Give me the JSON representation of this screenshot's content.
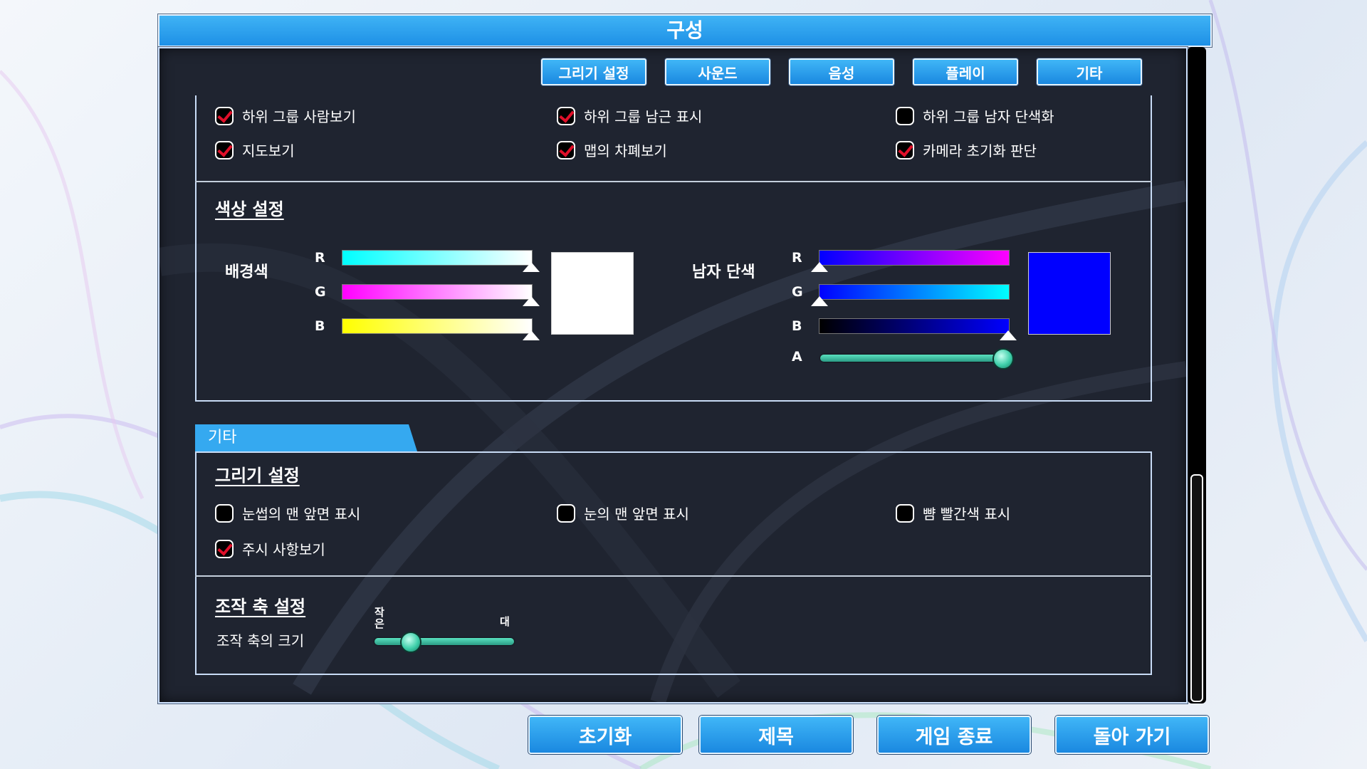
{
  "window": {
    "title": "구성"
  },
  "tabs": [
    "그리기 설정",
    "사운드",
    "음성",
    "플레이",
    "기타"
  ],
  "top_checkboxes": [
    {
      "label": "하위 그룹 사람보기",
      "checked": true
    },
    {
      "label": "하위 그룹 남근 표시",
      "checked": true
    },
    {
      "label": "하위 그룹 남자 단색화",
      "checked": false
    },
    {
      "label": "지도보기",
      "checked": true
    },
    {
      "label": "맵의 차폐보기",
      "checked": true
    },
    {
      "label": "카메라 초기화 판단",
      "checked": true
    }
  ],
  "color_settings": {
    "heading": "색상 설정",
    "background": {
      "label": "배경색",
      "channels": [
        {
          "name": "R",
          "value": 255,
          "gradient": [
            "#00ffff",
            "#ffffff"
          ]
        },
        {
          "name": "G",
          "value": 255,
          "gradient": [
            "#ff00ff",
            "#ffffff"
          ]
        },
        {
          "name": "B",
          "value": 255,
          "gradient": [
            "#ffff00",
            "#ffffff"
          ]
        }
      ],
      "swatch": "#ffffff"
    },
    "male_solid": {
      "label": "남자 단색",
      "channels": [
        {
          "name": "R",
          "value": 0,
          "gradient": [
            "#0000ff",
            "#ff00ff"
          ]
        },
        {
          "name": "G",
          "value": 0,
          "gradient": [
            "#0000ff",
            "#00ffff"
          ]
        },
        {
          "name": "B",
          "value": 255,
          "gradient": [
            "#000000",
            "#0000ff"
          ]
        }
      ],
      "alpha_label": "A",
      "alpha_value": 1.0,
      "swatch": "#0000ff"
    }
  },
  "other_tab": {
    "label": "기타"
  },
  "draw_settings": {
    "heading": "그리기 설정",
    "checkboxes": [
      {
        "label": "눈썹의 맨 앞면 표시",
        "checked": false
      },
      {
        "label": "눈의 맨 앞면 표시",
        "checked": false
      },
      {
        "label": "뺨 빨간색 표시",
        "checked": false
      },
      {
        "label": "주시 사항보기",
        "checked": true
      }
    ]
  },
  "manip_axis": {
    "heading": "조작 축 설정",
    "size_label": "조작 축의 크기",
    "min_label": "작은",
    "max_label": "대",
    "value": 0.25
  },
  "bottom_buttons": [
    "초기화",
    "제목",
    "게임 종료",
    "돌아 가기"
  ],
  "scroll_position": 0.6
}
